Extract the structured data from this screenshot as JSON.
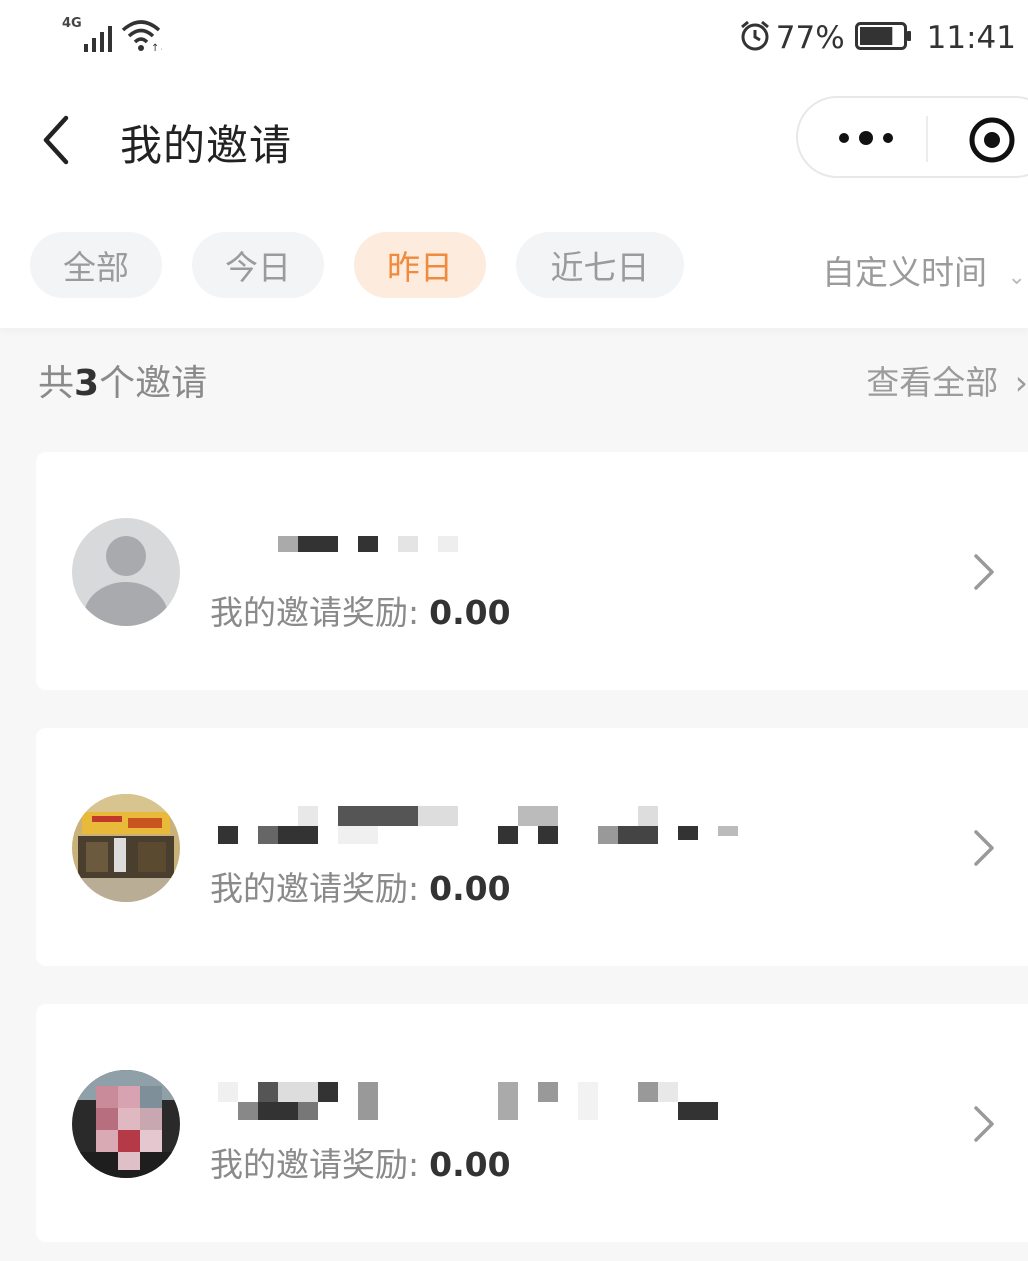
{
  "status_bar": {
    "network": "4G",
    "battery_percent": "77%",
    "time": "11:41",
    "battery_level": 0.77,
    "icons": [
      "signal-icon",
      "wifi-icon",
      "alarm-icon",
      "battery-icon"
    ]
  },
  "nav": {
    "title": "我的邀请",
    "back_icon": "chevron-left-icon",
    "more_icon": "more-dots-icon",
    "close_icon": "target-icon"
  },
  "filters": {
    "chips": [
      {
        "label": "全部",
        "active": false
      },
      {
        "label": "今日",
        "active": false
      },
      {
        "label": "昨日",
        "active": true
      },
      {
        "label": "近七日",
        "active": false
      }
    ],
    "custom_label": "自定义时间"
  },
  "summary": {
    "prefix": "共",
    "count": "3",
    "suffix": "个邀请",
    "view_all": "查看全部"
  },
  "invites": [
    {
      "reward_label": "我的邀请奖励:",
      "reward_value": "0.00",
      "avatar": "default-avatar"
    },
    {
      "reward_label": "我的邀请奖励:",
      "reward_value": "0.00",
      "avatar": "storefront-photo-avatar"
    },
    {
      "reward_label": "我的邀请奖励:",
      "reward_value": "0.00",
      "avatar": "person-photo-avatar"
    }
  ],
  "colors": {
    "accent": "#f08a3c",
    "accent_bg": "#fdebdd",
    "chip_bg": "#f3f4f5",
    "page_bg": "#f7f7f7",
    "muted_text": "#8a8a8a"
  }
}
